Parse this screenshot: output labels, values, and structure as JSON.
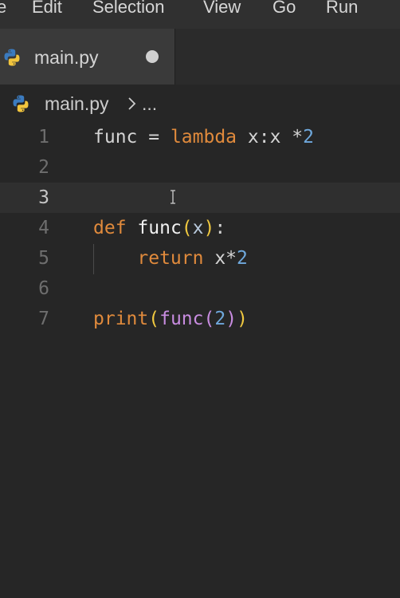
{
  "menubar": {
    "items": [
      "e",
      "Edit",
      "Selection",
      "View",
      "Go",
      "Run"
    ]
  },
  "tab": {
    "label": "main.py",
    "icon": "python-icon",
    "unsaved": true
  },
  "breadcrumb": {
    "file": "main.py",
    "separator_icon": "chevron-right-icon",
    "ellipsis": "..."
  },
  "editor": {
    "current_line": 3,
    "line_numbers": [
      "1",
      "2",
      "3",
      "4",
      "5",
      "6",
      "7"
    ],
    "lines": [
      [
        {
          "t": "func",
          "c": "plain"
        },
        {
          "t": " = ",
          "c": "plain"
        },
        {
          "t": "lambda",
          "c": "kw"
        },
        {
          "t": " x:x *",
          "c": "plain"
        },
        {
          "t": "2",
          "c": "num"
        }
      ],
      [],
      [],
      [
        {
          "t": "def",
          "c": "kw"
        },
        {
          "t": " ",
          "c": "plain"
        },
        {
          "t": "func",
          "c": "fn"
        },
        {
          "t": "(",
          "c": "paren-y"
        },
        {
          "t": "x",
          "c": "param"
        },
        {
          "t": ")",
          "c": "paren-y"
        },
        {
          "t": ":",
          "c": "plain"
        }
      ],
      [
        {
          "t": "    ",
          "c": "plain"
        },
        {
          "t": "return",
          "c": "kw"
        },
        {
          "t": " x*",
          "c": "plain"
        },
        {
          "t": "2",
          "c": "num"
        }
      ],
      [],
      [
        {
          "t": "print",
          "c": "kw"
        },
        {
          "t": "(",
          "c": "paren-y"
        },
        {
          "t": "func",
          "c": "paren-p"
        },
        {
          "t": "(",
          "c": "paren-p"
        },
        {
          "t": "2",
          "c": "num"
        },
        {
          "t": ")",
          "c": "paren-p"
        },
        {
          "t": ")",
          "c": "paren-y"
        }
      ]
    ]
  },
  "colors": {
    "keyword": "#e08a3c",
    "number": "#6fa8dc",
    "background": "#262626"
  }
}
